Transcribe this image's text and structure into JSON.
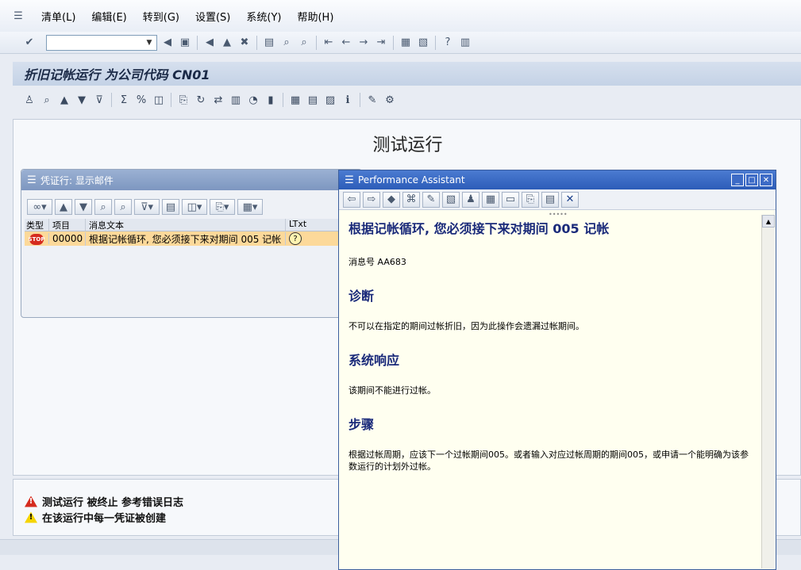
{
  "menu": {
    "items": [
      "清单(L)",
      "编辑(E)",
      "转到(G)",
      "设置(S)",
      "系统(Y)",
      "帮助(H)"
    ]
  },
  "page": {
    "title": "折旧记帐运行 为公司代码 CN01",
    "main_heading": "测试运行"
  },
  "log_window": {
    "title": "凭证行: 显示邮件",
    "columns": [
      "类型",
      "项目",
      "消息文本",
      "LTxt"
    ],
    "rows": [
      {
        "type_icon": "stop-icon",
        "type_icon_text": "STOP",
        "item": "00000",
        "text": "根据记帐循环, 您必须接下来对期间 005 记帐",
        "ltxt_icon": "help-icon"
      }
    ]
  },
  "status_messages": [
    {
      "icon": "warning-red-icon",
      "text": "测试运行  被终止  参考错误日志"
    },
    {
      "icon": "warning-yellow-icon",
      "text": "在该运行中每一凭证被创建"
    }
  ],
  "perf_assistant": {
    "title": "Performance Assistant",
    "heading": "根据记帐循环, 您必须接下来对期间  005 记帐",
    "msg_no": "消息号  AA683",
    "sections": [
      {
        "title": "诊断",
        "body": "不可以在指定的期间过帐折旧，因为此操作会遗漏过帐期间。"
      },
      {
        "title": "系统响应",
        "body": "该期间不能进行过帐。"
      },
      {
        "title": "步骤",
        "body": "根据过帐周期，应该下一个过帐期间005。或者输入对应过帐周期的期间005，或申请一个能明确为该参数运行的计划外过帐。"
      }
    ]
  },
  "colors": {
    "pa_background": "#fffff0",
    "pa_heading": "#1a2a7a",
    "row_highlight": "#fcd99a",
    "stop_red": "#d52b1e"
  }
}
